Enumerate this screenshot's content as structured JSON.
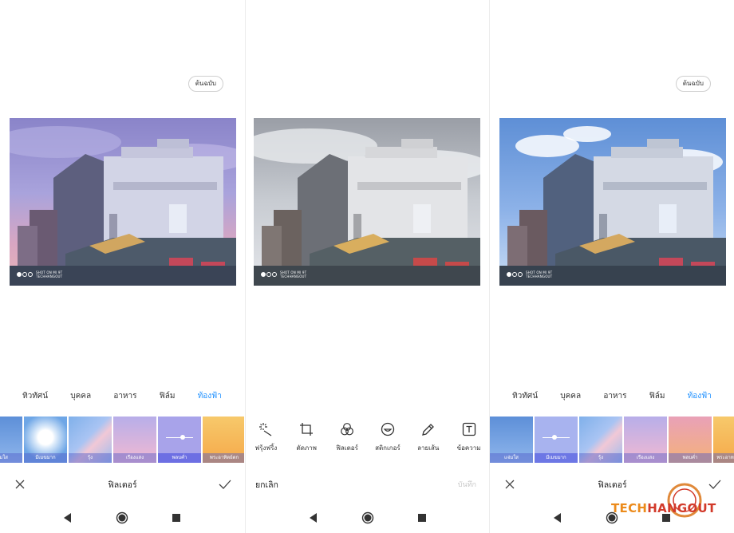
{
  "panel1": {
    "original_label": "ต้นฉบับ",
    "categories": [
      {
        "label": "ทิวทัศน์",
        "active": false
      },
      {
        "label": "บุคคล",
        "active": false
      },
      {
        "label": "อาหาร",
        "active": false
      },
      {
        "label": "ฟิล์ม",
        "active": false
      },
      {
        "label": "ท้องฟ้า",
        "active": true
      }
    ],
    "filters": [
      "แจ่มใส",
      "มีเมฆมาก",
      "รุ้ง",
      "เรืองแสง",
      "พลบค่ำ",
      "พระอาทิตย์ตก"
    ],
    "selected_filter": "พลบค่ำ",
    "title": "ฟิลเตอร์",
    "watermark_line1": "SHOT ON MI 9T",
    "watermark_line2": "TECHHANGOUT"
  },
  "panel2": {
    "tools": [
      "ฟรุ้งฟริ้ง",
      "ตัดภาพ",
      "ฟิลเตอร์",
      "สติกเกอร์",
      "ลายเส้น",
      "ข้อความ"
    ],
    "cancel": "ยกเลิก",
    "save": "บันทึก",
    "watermark_line1": "SHOT ON MI 9T",
    "watermark_line2": "TECHHANGOUT"
  },
  "panel3": {
    "original_label": "ต้นฉบับ",
    "categories": [
      {
        "label": "ทิวทัศน์",
        "active": false
      },
      {
        "label": "บุคคล",
        "active": false
      },
      {
        "label": "อาหาร",
        "active": false
      },
      {
        "label": "ฟิล์ม",
        "active": false
      },
      {
        "label": "ท้องฟ้า",
        "active": true
      }
    ],
    "filters": [
      "แจ่มใส",
      "มีเมฆมาก",
      "รุ้ง",
      "เรืองแสง",
      "พลบค่ำ",
      "พระอาท"
    ],
    "selected_filter": "มีเมฆมาก",
    "title": "ฟิลเตอร์",
    "watermark_line1": "SHOT ON MI 9T",
    "watermark_line2": "TECHHANGOUT"
  },
  "brand": {
    "part1": "TECH",
    "part2": "HANGOUT"
  },
  "icons": {
    "close": "close-icon",
    "check": "check-icon",
    "back": "back-icon",
    "home": "home-icon",
    "recents": "recents-icon"
  },
  "colors": {
    "accent": "#1e90ff",
    "brand_orange": "#ec8b1c",
    "brand_red": "#d23a2a"
  }
}
